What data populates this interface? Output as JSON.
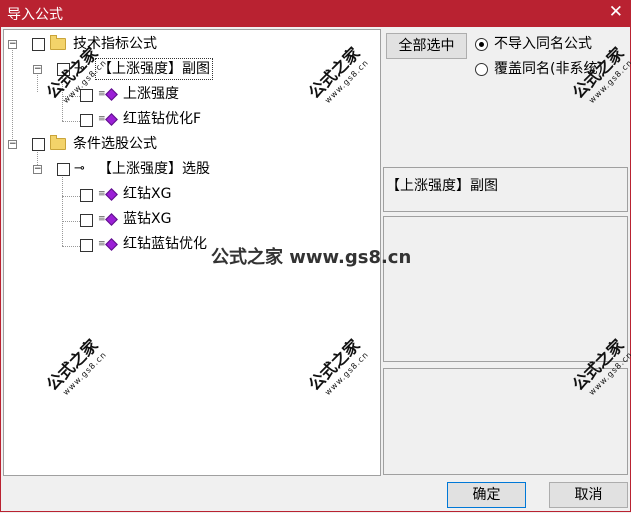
{
  "window": {
    "title": "导入公式",
    "close_glyph": "✕"
  },
  "tree": {
    "groups": [
      {
        "label": "技术指标公式",
        "item": {
          "label": "【上涨强度】副图",
          "children": [
            {
              "label": "上涨强度"
            },
            {
              "label": "红蓝钻优化F"
            }
          ]
        }
      },
      {
        "label": "条件选股公式",
        "item": {
          "label": "【上涨强度】选股",
          "children": [
            {
              "label": "红钻XG"
            },
            {
              "label": "蓝钻XG"
            },
            {
              "label": "红钻蓝钻优化"
            }
          ]
        }
      }
    ]
  },
  "right": {
    "select_all": "全部选中",
    "options": [
      {
        "label": "不导入同名公式",
        "selected": true
      },
      {
        "label": "覆盖同名(非系统)",
        "selected": false
      }
    ],
    "info": "【上涨强度】副图"
  },
  "footer": {
    "ok": "确定",
    "cancel": "取消"
  },
  "watermark": {
    "text": "公式之家",
    "url": "www.gs8.cn",
    "center": "公式之家 www.gs8.cn"
  },
  "icons": {
    "expander": "minus-box-icon",
    "folder": "folder-icon",
    "formula": "key-icon",
    "leaf": "gem-icon",
    "close": "close-icon"
  },
  "colors": {
    "titlebar": "#b92231",
    "gem": "#9b1fd6",
    "folder": "#f3d36a"
  }
}
